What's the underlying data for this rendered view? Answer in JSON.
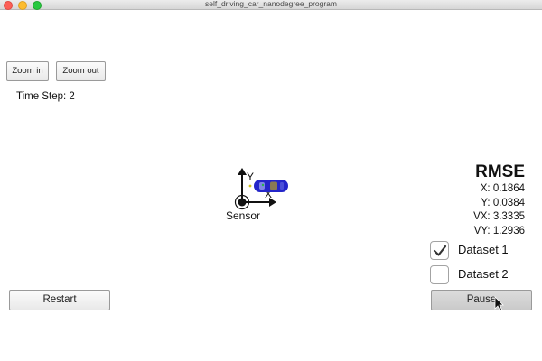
{
  "window": {
    "title": "self_driving_car_nanodegree_program"
  },
  "toolbar": {
    "zoom_in_label": "Zoom in",
    "zoom_out_label": "Zoom out"
  },
  "status": {
    "time_step": "Time Step: 2"
  },
  "scene": {
    "sensor_label": "Sensor",
    "axis_y_label": "Y",
    "axis_x_label": "X",
    "car_color": "#2426c9"
  },
  "rmse": {
    "heading": "RMSE",
    "x": "X: 0.1864",
    "y": "Y: 0.0384",
    "vx": "VX: 3.3335",
    "vy": "VY: 1.2936"
  },
  "datasets": [
    {
      "label": "Dataset 1",
      "checked": true
    },
    {
      "label": "Dataset 2",
      "checked": false
    }
  ],
  "controls": {
    "restart_label": "Restart",
    "pause_label": "Pause"
  },
  "icons": {
    "checkmark": "checkmark-icon",
    "cursor": "mouse-pointer-icon"
  }
}
